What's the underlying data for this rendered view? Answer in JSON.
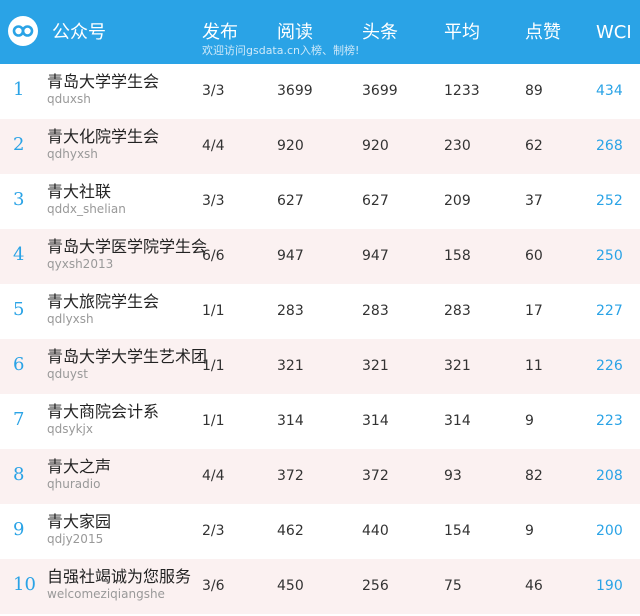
{
  "header": {
    "account_label": "公众号",
    "publish_label": "发布",
    "reads_label": "阅读",
    "headline_label": "头条",
    "avg_label": "平均",
    "likes_label": "点赞",
    "wci_label": "WCI",
    "subtitle": "欢迎访问gsdata.cn入榜、制榜!"
  },
  "colors": {
    "header_bg": "#2aa3e6",
    "accent": "#2aa3e6",
    "alt_row": "#fbf1f1"
  },
  "rows": [
    {
      "rank": "1",
      "name": "青岛大学学生会",
      "account": "qduxsh",
      "publish": "3/3",
      "reads": "3699",
      "headline": "3699",
      "avg": "1233",
      "likes": "89",
      "wci": "434"
    },
    {
      "rank": "2",
      "name": "青大化院学生会",
      "account": "qdhyxsh",
      "publish": "4/4",
      "reads": "920",
      "headline": "920",
      "avg": "230",
      "likes": "62",
      "wci": "268"
    },
    {
      "rank": "3",
      "name": "青大社联",
      "account": "qddx_shelian",
      "publish": "3/3",
      "reads": "627",
      "headline": "627",
      "avg": "209",
      "likes": "37",
      "wci": "252"
    },
    {
      "rank": "4",
      "name": "青岛大学医学院学生会",
      "account": "qyxsh2013",
      "publish": "6/6",
      "reads": "947",
      "headline": "947",
      "avg": "158",
      "likes": "60",
      "wci": "250"
    },
    {
      "rank": "5",
      "name": "青大旅院学生会",
      "account": "qdlyxsh",
      "publish": "1/1",
      "reads": "283",
      "headline": "283",
      "avg": "283",
      "likes": "17",
      "wci": "227"
    },
    {
      "rank": "6",
      "name": "青岛大学大学生艺术团",
      "account": "qduyst",
      "publish": "1/1",
      "reads": "321",
      "headline": "321",
      "avg": "321",
      "likes": "11",
      "wci": "226"
    },
    {
      "rank": "7",
      "name": "青大商院会计系",
      "account": "qdsykjx",
      "publish": "1/1",
      "reads": "314",
      "headline": "314",
      "avg": "314",
      "likes": "9",
      "wci": "223"
    },
    {
      "rank": "8",
      "name": "青大之声",
      "account": "qhuradio",
      "publish": "4/4",
      "reads": "372",
      "headline": "372",
      "avg": "93",
      "likes": "82",
      "wci": "208"
    },
    {
      "rank": "9",
      "name": "青大家园",
      "account": "qdjy2015",
      "publish": "2/3",
      "reads": "462",
      "headline": "440",
      "avg": "154",
      "likes": "9",
      "wci": "200"
    },
    {
      "rank": "10",
      "name": "自强社竭诚为您服务",
      "account": "welcomeziqiangshe",
      "publish": "3/6",
      "reads": "450",
      "headline": "256",
      "avg": "75",
      "likes": "46",
      "wci": "190"
    }
  ]
}
